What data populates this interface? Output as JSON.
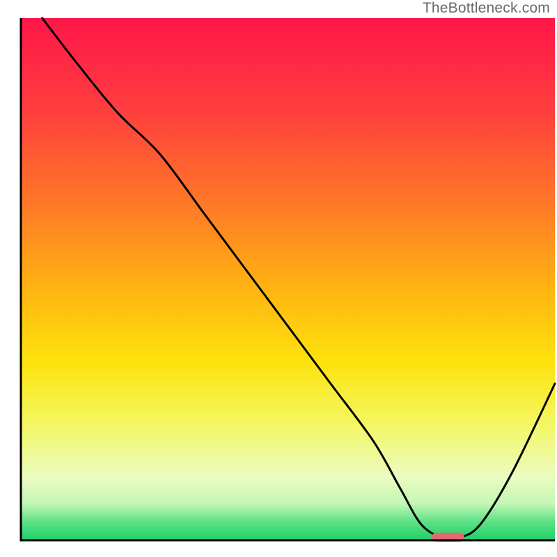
{
  "watermark": "TheBottleneck.com",
  "chart_data": {
    "type": "line",
    "title": "",
    "xlabel": "",
    "ylabel": "",
    "xlim": [
      0,
      100
    ],
    "ylim": [
      0,
      100
    ],
    "grid": false,
    "legend": false,
    "series": [
      {
        "name": "bottleneck-curve",
        "x": [
          4,
          10,
          18,
          26,
          34,
          42,
          50,
          58,
          66,
          71,
          75,
          79,
          82,
          86,
          92,
          100
        ],
        "y": [
          100,
          92,
          82,
          74,
          63,
          52,
          41,
          30,
          19,
          10,
          3,
          0.5,
          0.5,
          3,
          13,
          30
        ]
      }
    ],
    "marker": {
      "name": "optimal-range",
      "x_start": 77,
      "x_end": 83,
      "y": 0.6,
      "color": "#e46a6f"
    },
    "gradient_stops": [
      {
        "offset": 0.0,
        "color": "#ff1649"
      },
      {
        "offset": 0.18,
        "color": "#ff3f3e"
      },
      {
        "offset": 0.36,
        "color": "#ff7a26"
      },
      {
        "offset": 0.52,
        "color": "#ffb412"
      },
      {
        "offset": 0.66,
        "color": "#fde30e"
      },
      {
        "offset": 0.78,
        "color": "#f4f765"
      },
      {
        "offset": 0.88,
        "color": "#eafcc1"
      },
      {
        "offset": 0.93,
        "color": "#c3f6b5"
      },
      {
        "offset": 0.965,
        "color": "#5be185"
      },
      {
        "offset": 1.0,
        "color": "#1ecf6b"
      }
    ]
  }
}
